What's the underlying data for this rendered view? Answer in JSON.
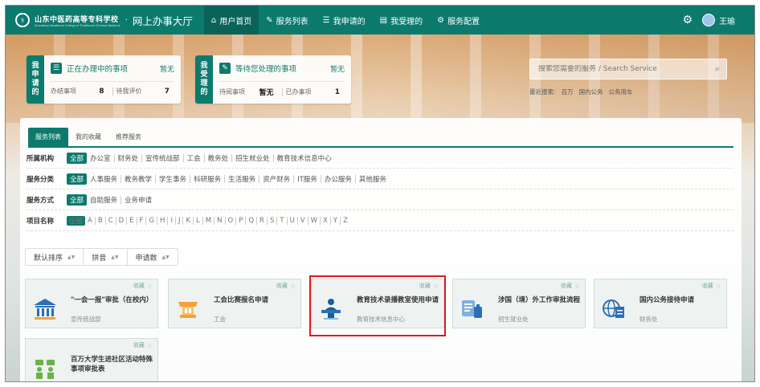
{
  "nav": {
    "school": "山东中医药高等专科学校",
    "school_en": "Shandong Vocational College of Traditional Chinese Medicine",
    "dot": "·",
    "title": "网上办事大厅",
    "items": [
      {
        "label": "用户首页",
        "icon": "home-icon",
        "active": true
      },
      {
        "label": "服务列表",
        "icon": "edit-icon"
      },
      {
        "label": "我申请的",
        "icon": "list-icon"
      },
      {
        "label": "我受理的",
        "icon": "list-icon"
      },
      {
        "label": "服务配置",
        "icon": "gears-icon"
      }
    ],
    "user": "王瑜"
  },
  "apply": {
    "tag": [
      "我",
      "申",
      "请",
      "的"
    ],
    "title": "正在办理中的事项",
    "none": "暂无",
    "todo_label": "办结事项",
    "todo_value": "8",
    "eval_label": "待我评价",
    "eval_value": "7"
  },
  "accept": {
    "tag": [
      "我",
      "受",
      "理",
      "的"
    ],
    "title": "等待您处理的事项",
    "none": "暂无",
    "wait_label": "待阅事项",
    "wait_value": "暂无",
    "done_label": "已办事项",
    "done_value": "1"
  },
  "search": {
    "placeholder": "搜索您需要的服务 / Search Service",
    "recent_label": "最近搜索:",
    "recent": [
      "百万",
      "国内公务",
      "公务用车"
    ]
  },
  "tabs": [
    "服务列表",
    "我的收藏",
    "推荐服务"
  ],
  "filters": {
    "org": {
      "label": "所属机构",
      "items": [
        "全部",
        "办公室",
        "财务处",
        "宣传统战部",
        "工会",
        "教务处",
        "招生就业处",
        "教育技术信息中心"
      ]
    },
    "cat": {
      "label": "服务分类",
      "items": [
        "全部",
        "人事服务",
        "教务教学",
        "学生事务",
        "科研服务",
        "生活服务",
        "资产财务",
        "IT服务",
        "办公服务",
        "其他服务"
      ]
    },
    "mode": {
      "label": "服务方式",
      "items": [
        "全部",
        "自助服务",
        "业务申请"
      ]
    },
    "name": {
      "label": "项目名称",
      "items": [
        "全部",
        "A",
        "B",
        "C",
        "D",
        "E",
        "F",
        "G",
        "H",
        "I",
        "J",
        "K",
        "L",
        "M",
        "N",
        "O",
        "P",
        "Q",
        "R",
        "S",
        "T",
        "U",
        "V",
        "W",
        "X",
        "Y",
        "Z"
      ]
    }
  },
  "sort": [
    "默认排序",
    "拼音",
    "申请数"
  ],
  "fav_label": "收藏",
  "cards": [
    {
      "title": "\"一会一报\"审批（在校内）",
      "dept": "宣传统战部",
      "icon": "bank-icon"
    },
    {
      "title": "工会比赛报名申请",
      "dept": "工会",
      "icon": "trophy-icon"
    },
    {
      "title": "教育技术录播教室使用申请",
      "dept": "教育技术信息中心",
      "icon": "lectern-icon"
    },
    {
      "title": "涉国（境）外工作审批流程",
      "dept": "招生就业处",
      "icon": "passport-luggage-icon"
    },
    {
      "title": "国内公务接待申请",
      "dept": "财务处",
      "icon": "globe-doc-icon"
    },
    {
      "title": "百万大学生进社区活动特殊事项审批表",
      "dept": "",
      "icon": "community-icon"
    }
  ],
  "colors": {
    "primary": "#0d7a6e",
    "highlight": "#e0181c"
  }
}
